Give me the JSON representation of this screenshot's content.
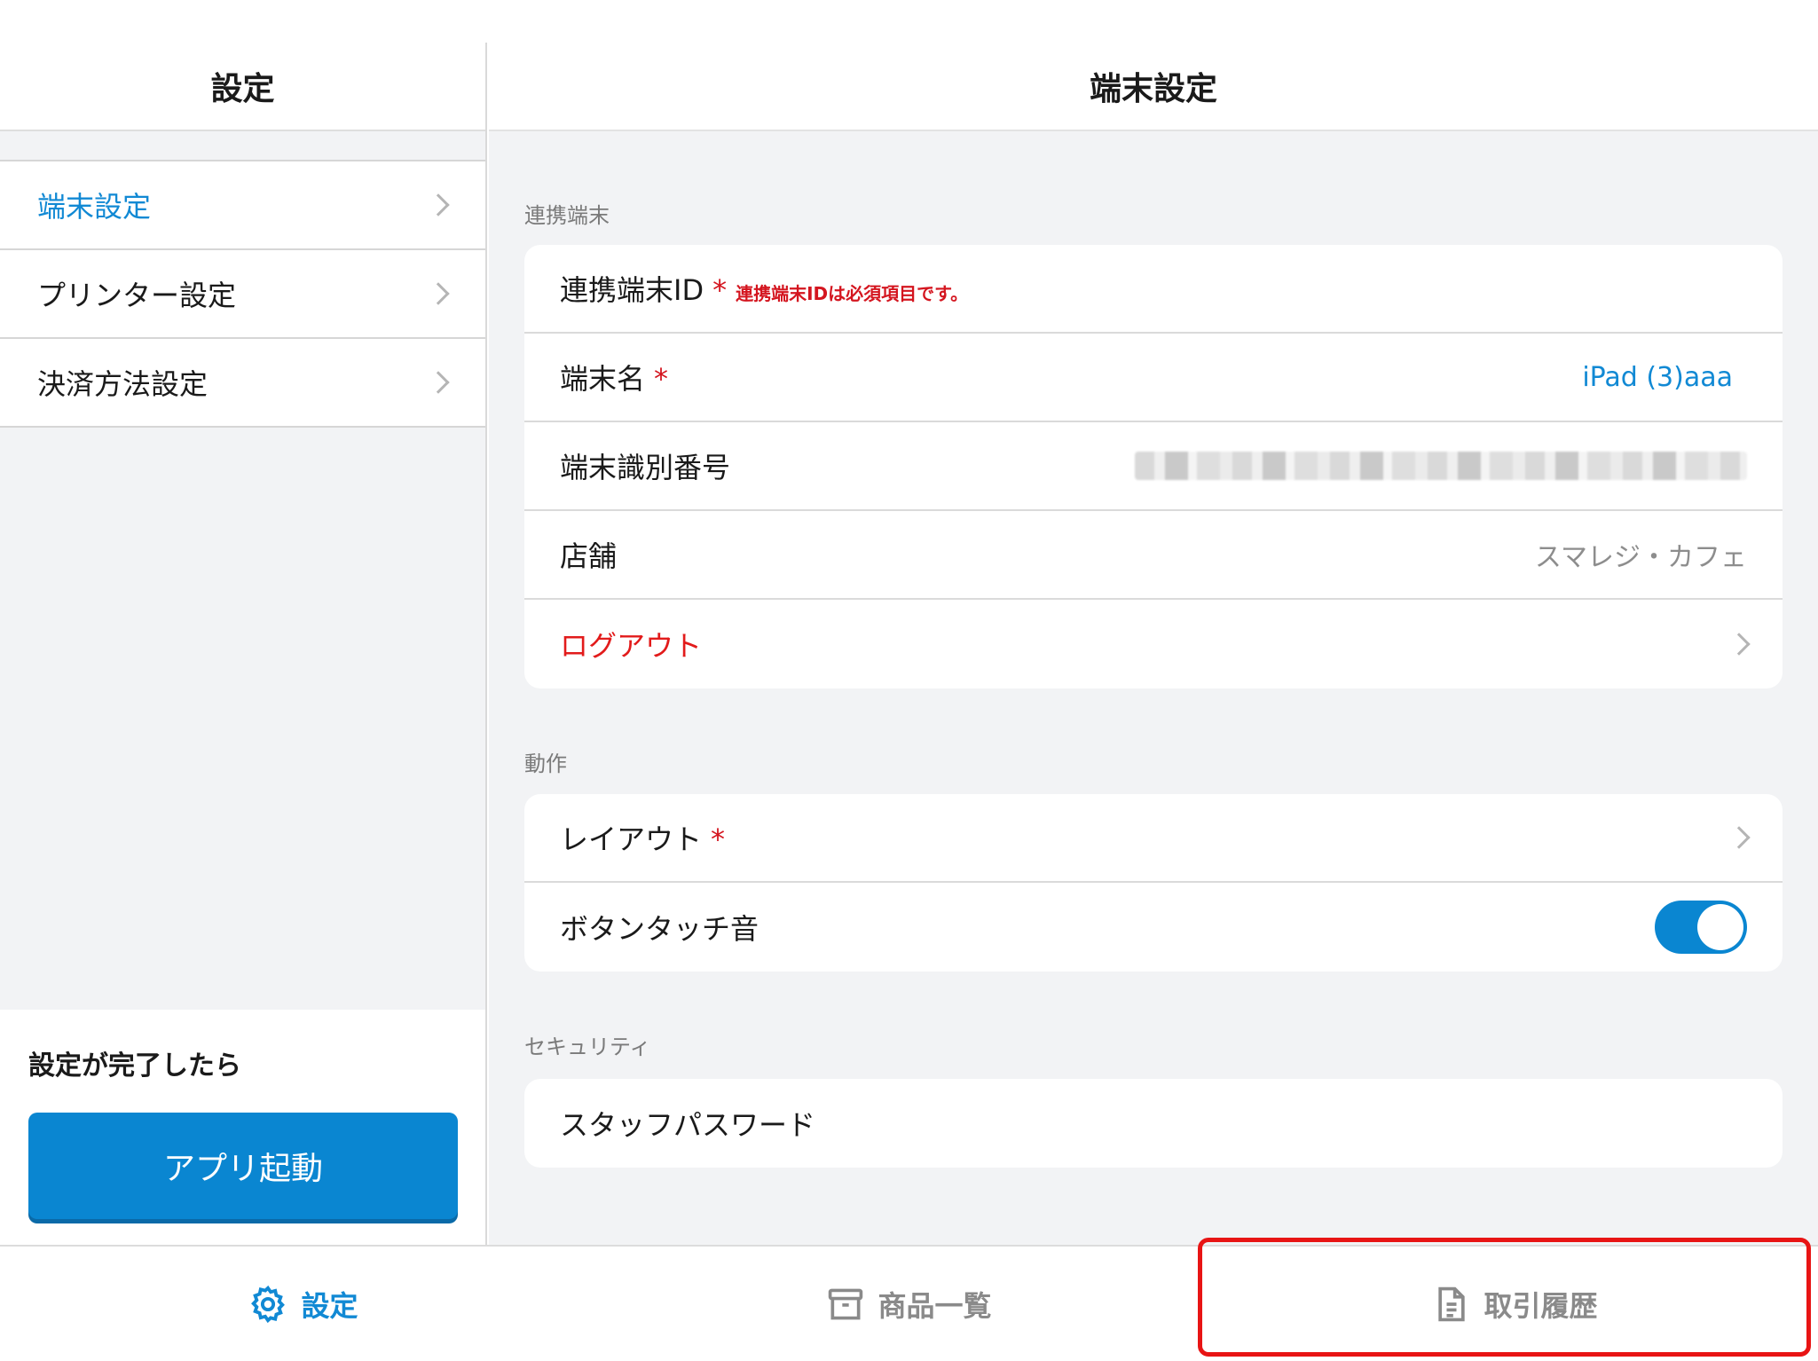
{
  "sidebar": {
    "title": "設定",
    "items": [
      {
        "label": "端末設定",
        "active": true
      },
      {
        "label": "プリンター設定",
        "active": false
      },
      {
        "label": "決済方法設定",
        "active": false
      }
    ],
    "footer_caption": "設定が完了したら",
    "launch_button": "アプリ起動"
  },
  "main": {
    "title": "端末設定",
    "sections": {
      "linked": {
        "label": "連携端末",
        "linked_id_label": "連携端末ID",
        "required_mark": "*",
        "linked_id_error": "連携端末IDは必須項目です。",
        "device_name_label": "端末名",
        "device_name_value": "iPad (3)aaa",
        "device_serial_label": "端末識別番号",
        "store_label": "店舗",
        "store_value": "スマレジ・カフェ",
        "logout_label": "ログアウト"
      },
      "behavior": {
        "label": "動作",
        "layout_label": "レイアウト",
        "sound_label": "ボタンタッチ音",
        "sound_on": true
      },
      "security": {
        "label": "セキュリティ",
        "staff_password_label": "スタッフパスワード"
      }
    }
  },
  "tabbar": {
    "settings": "設定",
    "products": "商品一覧",
    "history": "取引履歴"
  },
  "colors": {
    "accent": "#0a86d1",
    "error": "#d4151f",
    "highlight": "#e81414"
  }
}
